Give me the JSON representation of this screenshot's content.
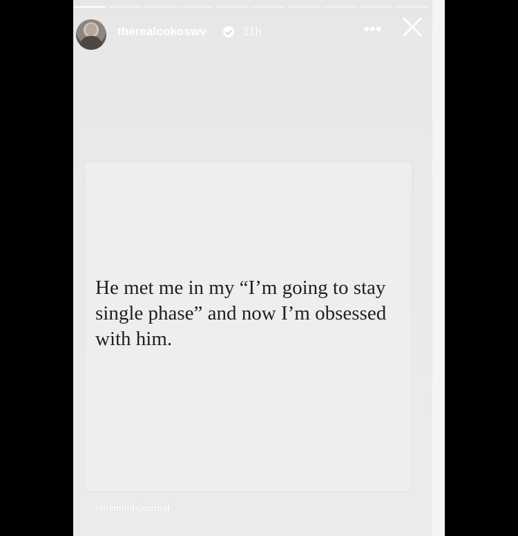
{
  "story": {
    "progress_segments": 10,
    "active_segment_index": 0,
    "header": {
      "username": "therealcokoswv",
      "time_ago": "11h",
      "more_icon": "more-horizontal-icon",
      "close_icon": "close-icon"
    },
    "quote": "He met me in my “I’m going to stay single phase” and now I’m obsessed with him.",
    "watermark": "@themindsjournal"
  },
  "colors": {
    "background": "#000000",
    "story_bg": "#e9e8e8",
    "card_bg": "#efeeee",
    "text": "#1f1f1f",
    "header_text": "#ffffff"
  }
}
